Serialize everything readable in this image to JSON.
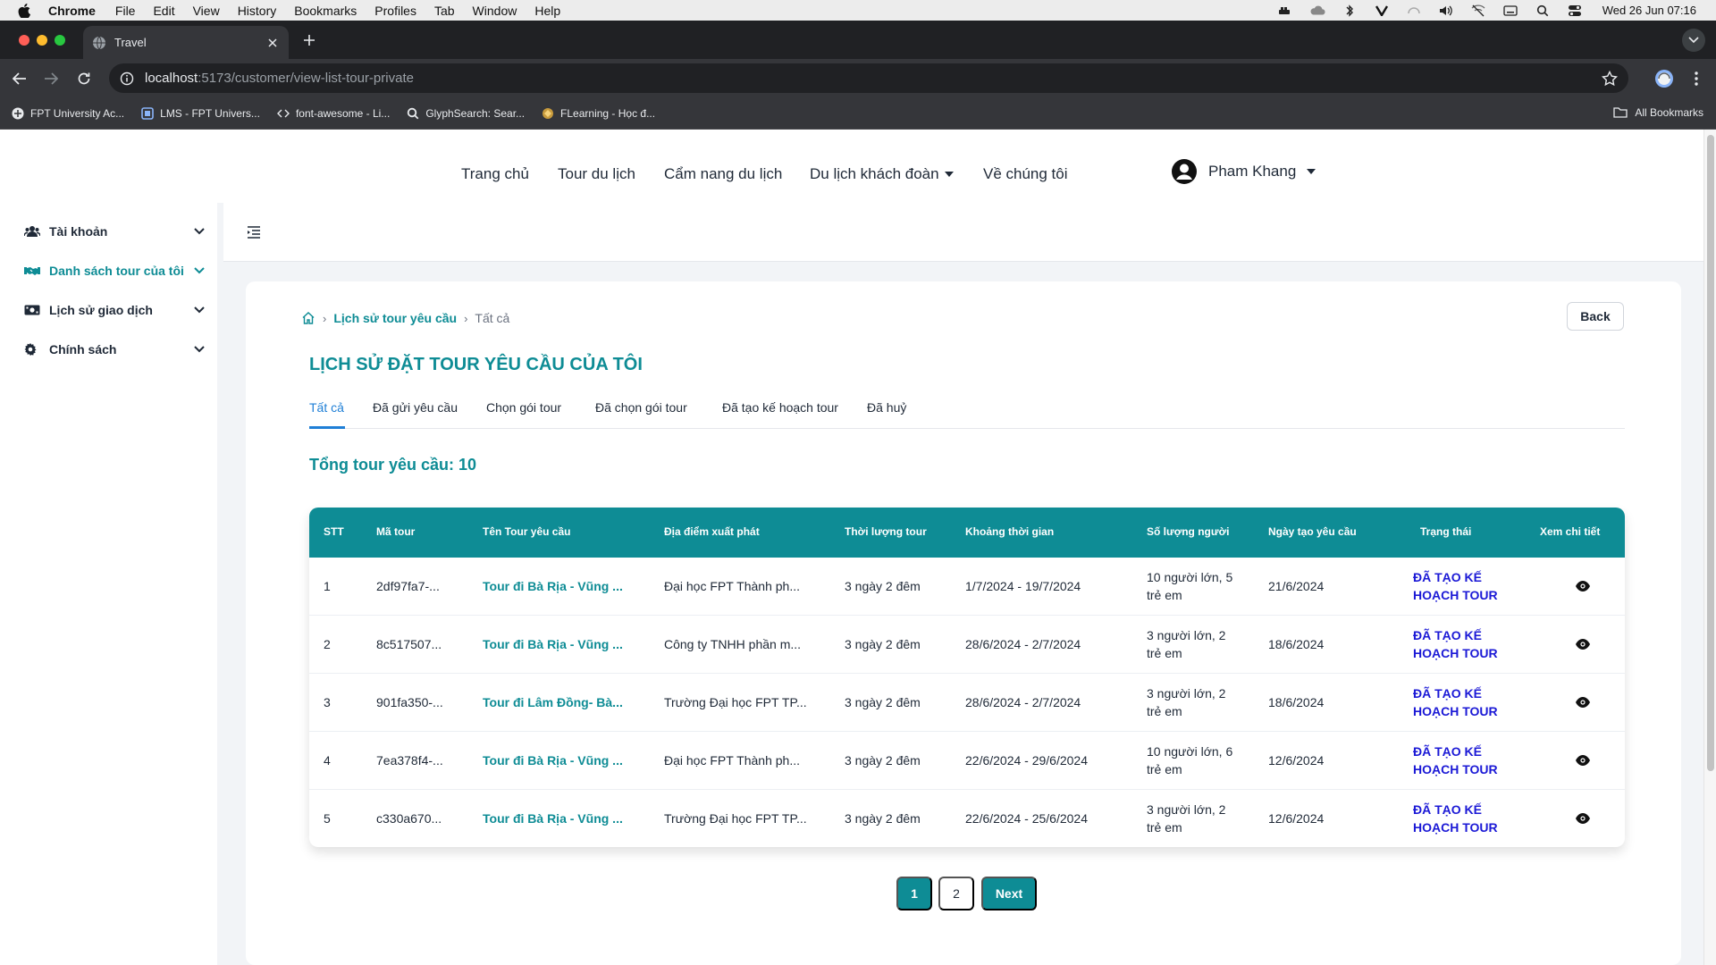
{
  "menubar": {
    "app": "Chrome",
    "items": [
      "File",
      "Edit",
      "View",
      "History",
      "Bookmarks",
      "Profiles",
      "Tab",
      "Window",
      "Help"
    ],
    "clock": "Wed 26 Jun  07:16"
  },
  "browser": {
    "tab_title": "Travel",
    "url_host": "localhost",
    "url_path": ":5173/customer/view-list-tour-private",
    "bookmarks": [
      "FPT University Ac...",
      "LMS - FPT Univers...",
      "font-awesome - Li...",
      "GlyphSearch: Sear...",
      "FLearning - Học đ..."
    ],
    "all_bookmarks": "All Bookmarks"
  },
  "topnav": {
    "links": [
      "Trang chủ",
      "Tour du lịch",
      "Cẩm nang du lịch",
      "Du lịch khách đoàn",
      "Về chúng tôi"
    ],
    "user_name": "Pham Khang"
  },
  "sidebar": {
    "items": [
      {
        "label": "Tài khoản",
        "icon": "users-icon"
      },
      {
        "label": "Danh sách tour của tôi",
        "icon": "handshake-icon"
      },
      {
        "label": "Lịch sử giao dịch",
        "icon": "money-icon"
      },
      {
        "label": "Chính sách",
        "icon": "gear-icon"
      }
    ]
  },
  "breadcrumb": {
    "link": "Lịch sử tour yêu cầu",
    "current": "Tất cả"
  },
  "back_label": "Back",
  "page_title": "LỊCH SỬ ĐẶT TOUR YÊU CẦU CỦA TÔI",
  "tabs": [
    "Tất cả",
    "Đã gửi yêu cầu",
    "Chọn gói tour",
    "Đã chọn gói tour",
    "Đã tạo kế hoạch tour",
    "Đã huỷ"
  ],
  "total_label": "Tổng tour yêu cầu: 10",
  "table": {
    "headers": [
      "STT",
      "Mã tour",
      "Tên Tour yêu cầu",
      "Địa điểm xuất phát",
      "Thời lượng tour",
      "Khoảng thời gian",
      "Số lượng người",
      "Ngày tạo yêu cầu",
      "Trạng thái",
      "Xem chi tiết"
    ],
    "rows": [
      {
        "stt": "1",
        "code": "2df97fa7-...",
        "name": "Tour đi Bà Rịa - Vũng ...",
        "from": "Đại học FPT Thành ph...",
        "duration": "3 ngày 2 đêm",
        "range": "1/7/2024 - 19/7/2024",
        "people1": "10 người lớn, 5",
        "people2": "trẻ em",
        "created": "21/6/2024",
        "status1": "ĐÃ TẠO KẾ",
        "status2": "HOẠCH TOUR"
      },
      {
        "stt": "2",
        "code": "8c517507...",
        "name": "Tour đi Bà Rịa - Vũng ...",
        "from": "Công ty TNHH phần m...",
        "duration": "3 ngày 2 đêm",
        "range": "28/6/2024 - 2/7/2024",
        "people1": "3 người lớn, 2",
        "people2": "trẻ em",
        "created": "18/6/2024",
        "status1": "ĐÃ TẠO KẾ",
        "status2": "HOẠCH TOUR"
      },
      {
        "stt": "3",
        "code": "901fa350-...",
        "name": "Tour đi Lâm Đồng- Bà...",
        "from": "Trường Đại học FPT TP...",
        "duration": "3 ngày 2 đêm",
        "range": "28/6/2024 - 2/7/2024",
        "people1": "3 người lớn, 2",
        "people2": "trẻ em",
        "created": "18/6/2024",
        "status1": "ĐÃ TẠO KẾ",
        "status2": "HOẠCH TOUR"
      },
      {
        "stt": "4",
        "code": "7ea378f4-...",
        "name": "Tour đi Bà Rịa - Vũng ...",
        "from": "Đại học FPT Thành ph...",
        "duration": "3 ngày 2 đêm",
        "range": "22/6/2024 - 29/6/2024",
        "people1": "10 người lớn, 6",
        "people2": "trẻ em",
        "created": "12/6/2024",
        "status1": "ĐÃ TẠO KẾ",
        "status2": "HOẠCH TOUR"
      },
      {
        "stt": "5",
        "code": "c330a670...",
        "name": "Tour đi Bà Rịa - Vũng ...",
        "from": "Trường Đại học FPT TP...",
        "duration": "3 ngày 2 đêm",
        "range": "22/6/2024 - 25/6/2024",
        "people1": "3 người lớn, 2",
        "people2": "trẻ em",
        "created": "12/6/2024",
        "status1": "ĐÃ TẠO KẾ",
        "status2": "HOẠCH TOUR"
      }
    ]
  },
  "pagination": {
    "current": "1",
    "page2": "2",
    "next": "Next"
  },
  "colors": {
    "accent": "#0e8c95",
    "status": "#1b19d6",
    "tab_active": "#1f7fd6"
  }
}
